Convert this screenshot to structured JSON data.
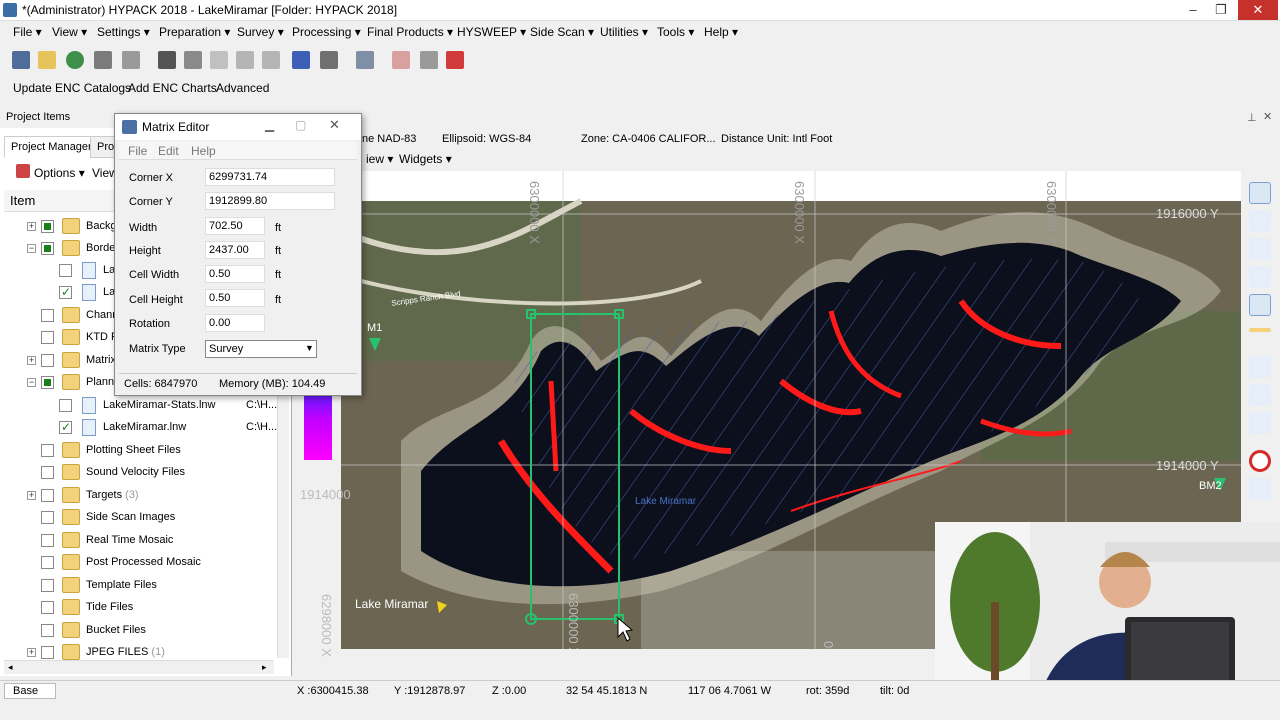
{
  "window": {
    "title": "*(Administrator) HYPACK 2018 - LakeMiramar  [Folder: HYPACK 2018]"
  },
  "menubar": [
    "File",
    "View",
    "Settings",
    "Preparation",
    "Survey",
    "Processing",
    "Final Products",
    "HYSWEEP",
    "Side Scan",
    "Utilities",
    "Tools",
    "Help"
  ],
  "enc": {
    "update": "Update ENC Catalogs",
    "add": "Add ENC Charts",
    "advanced": "Advanced"
  },
  "project": {
    "header": "Project Items",
    "tabs": [
      "Project Manager",
      "Proj"
    ],
    "options": "Options",
    "view": "View",
    "column": "Item",
    "rows": [
      {
        "label": "Backgr",
        "count": ""
      },
      {
        "label": "Border",
        "count": ""
      },
      {
        "label": "La",
        "count": ""
      },
      {
        "label": "La",
        "count": ""
      },
      {
        "label": "Chann",
        "count": ""
      },
      {
        "label": "KTD Fi",
        "count": ""
      },
      {
        "label": "Matrix",
        "count": ""
      },
      {
        "label": "Planne",
        "count": ""
      },
      {
        "label": "LakeMiramar-Stats.lnw",
        "path": "C:\\H...",
        "count": ""
      },
      {
        "label": "LakeMiramar.lnw",
        "path": "C:\\H...",
        "count": ""
      },
      {
        "label": "Plotting Sheet Files",
        "count": ""
      },
      {
        "label": "Sound Velocity Files",
        "count": ""
      },
      {
        "label": "Targets",
        "count": "(3)"
      },
      {
        "label": "Side Scan Images",
        "count": ""
      },
      {
        "label": "Real Time Mosaic",
        "count": ""
      },
      {
        "label": "Post Processed Mosaic",
        "count": ""
      },
      {
        "label": "Template Files",
        "count": ""
      },
      {
        "label": "Tide Files",
        "count": ""
      },
      {
        "label": "Bucket Files",
        "count": ""
      },
      {
        "label": "JPEG FILES",
        "count": "(1)"
      }
    ]
  },
  "matrix_editor": {
    "title": "Matrix Editor",
    "menu": [
      "File",
      "Edit",
      "Help"
    ],
    "fields": {
      "corner_x": {
        "label": "Corner X",
        "value": "6299731.74"
      },
      "corner_y": {
        "label": "Corner Y",
        "value": "1912899.80"
      },
      "width": {
        "label": "Width",
        "value": "702.50",
        "unit": "ft"
      },
      "height": {
        "label": "Height",
        "value": "2437.00",
        "unit": "ft"
      },
      "cell_width": {
        "label": "Cell Width",
        "value": "0.50",
        "unit": "ft"
      },
      "cell_height": {
        "label": "Cell Height",
        "value": "0.50",
        "unit": "ft"
      },
      "rotation": {
        "label": "Rotation",
        "value": "0.00"
      }
    },
    "matrix_type": {
      "label": "Matrix Type",
      "value": "Survey"
    },
    "status": {
      "cells": "Cells: 6847970",
      "memory": "Memory (MB): 104.49"
    }
  },
  "map": {
    "info": {
      "datum": "ne NAD-83",
      "ellipsoid": "Ellipsoid: WGS-84",
      "zone": "Zone: CA-0406 CALIFOR...",
      "distance": "Distance Unit: Intl Foot"
    },
    "menu": {
      "view": "iew",
      "widgets": "Widgets"
    },
    "grid_labels": {
      "x1": "6300000 X",
      "x2": "6300000 X",
      "x3": "6300000 X",
      "y1": "1916000 Y",
      "y2": "1914000 Y",
      "left_y": "1914000",
      "bottom_x": "6298000 X",
      "bottom_x2": "6300000 X",
      "bottom_x3": "00 X"
    },
    "labels": {
      "lake": "Lake Miramar",
      "lake_small": "Lake Miramar",
      "bm1": "M1",
      "bm2": "BM2",
      "road": "Scripps Ranch Blvd"
    }
  },
  "status": {
    "base": "Base",
    "x": "X :6300415.38",
    "y": "Y :1912878.97",
    "z": "Z :0.00",
    "lat": "32 54 45.1813 N",
    "lon": "117 06 4.7061 W",
    "rot": "rot: 359d",
    "tilt": "tilt:   0d"
  },
  "colors": {
    "accent": "#3a6ea5",
    "survey_red": "#ff1a1a",
    "matrix_green": "#27c26b",
    "water": "#0c0f1c"
  }
}
